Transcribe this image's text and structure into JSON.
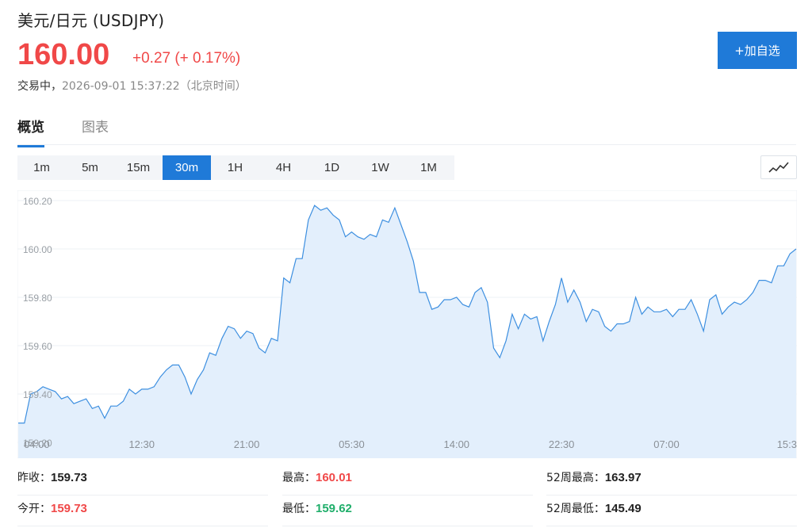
{
  "header": {
    "title": "美元/日元  (USDJPY)",
    "price": "160.00",
    "change": "+0.27 (+ 0.17%)",
    "status_label": "交易中，",
    "timestamp": "2026-09-01 15:37:22（北京时间）",
    "add_button": "+加自选"
  },
  "colors": {
    "accent": "#1f7ad8",
    "up": "#f04848",
    "down": "#1fae6a",
    "area_fill": "#e3effc",
    "line": "#3d8fe0"
  },
  "tabs": [
    {
      "label": "概览",
      "active": true
    },
    {
      "label": "图表",
      "active": false
    }
  ],
  "periods": [
    {
      "label": "1m",
      "active": false
    },
    {
      "label": "5m",
      "active": false
    },
    {
      "label": "15m",
      "active": false
    },
    {
      "label": "30m",
      "active": true
    },
    {
      "label": "1H",
      "active": false
    },
    {
      "label": "4H",
      "active": false
    },
    {
      "label": "1D",
      "active": false
    },
    {
      "label": "1W",
      "active": false
    },
    {
      "label": "1M",
      "active": false
    }
  ],
  "chart_type_icon": "line-chart-icon",
  "chart_data": {
    "type": "area",
    "ylim": [
      159.2,
      160.2
    ],
    "y_ticks": [
      "160.20",
      "160.00",
      "159.80",
      "159.60",
      "159.40",
      "159.20"
    ],
    "x_ticks": [
      "04:00",
      "12:30",
      "21:00",
      "05:30",
      "14:00",
      "22:30",
      "07:00",
      "15:3"
    ],
    "x_tick_index": [
      3,
      20,
      37,
      54,
      71,
      88,
      105,
      122
    ],
    "values": [
      159.28,
      159.28,
      159.4,
      159.41,
      159.43,
      159.42,
      159.41,
      159.38,
      159.39,
      159.36,
      159.37,
      159.38,
      159.34,
      159.35,
      159.3,
      159.35,
      159.35,
      159.37,
      159.42,
      159.4,
      159.42,
      159.42,
      159.43,
      159.47,
      159.5,
      159.52,
      159.52,
      159.47,
      159.4,
      159.46,
      159.5,
      159.57,
      159.56,
      159.63,
      159.68,
      159.67,
      159.63,
      159.66,
      159.65,
      159.59,
      159.57,
      159.63,
      159.62,
      159.88,
      159.86,
      159.96,
      159.96,
      160.12,
      160.18,
      160.16,
      160.17,
      160.14,
      160.12,
      160.05,
      160.07,
      160.05,
      160.04,
      160.06,
      160.05,
      160.12,
      160.11,
      160.17,
      160.1,
      160.03,
      159.95,
      159.82,
      159.82,
      159.75,
      159.76,
      159.79,
      159.79,
      159.8,
      159.77,
      159.76,
      159.82,
      159.84,
      159.78,
      159.59,
      159.55,
      159.62,
      159.73,
      159.67,
      159.73,
      159.71,
      159.72,
      159.62,
      159.7,
      159.77,
      159.88,
      159.78,
      159.83,
      159.78,
      159.7,
      159.75,
      159.74,
      159.68,
      159.66,
      159.69,
      159.69,
      159.7,
      159.8,
      159.73,
      159.76,
      159.74,
      159.74,
      159.75,
      159.72,
      159.75,
      159.75,
      159.79,
      159.73,
      159.66,
      159.79,
      159.81,
      159.73,
      159.76,
      159.78,
      159.77,
      159.79,
      159.82,
      159.87,
      159.87,
      159.86,
      159.93,
      159.93,
      159.98,
      160.0
    ]
  },
  "stats": [
    {
      "label": "昨收：",
      "value": "159.73",
      "tone": "dark"
    },
    {
      "label": "最高：",
      "value": "160.01",
      "tone": "red"
    },
    {
      "label": "52周最高：",
      "value": "163.97",
      "tone": "dark"
    },
    {
      "label": "今开：",
      "value": "159.73",
      "tone": "red"
    },
    {
      "label": "最低：",
      "value": "159.62",
      "tone": "green"
    },
    {
      "label": "52周最低：",
      "value": "145.49",
      "tone": "dark"
    }
  ]
}
